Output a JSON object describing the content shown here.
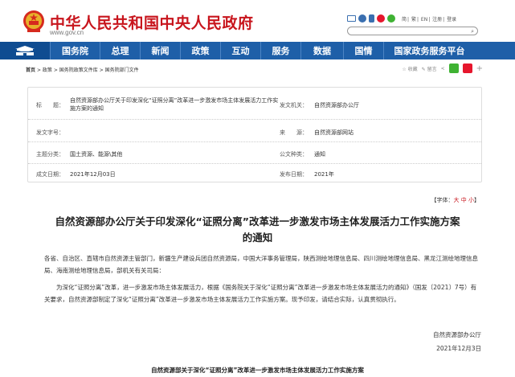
{
  "header": {
    "site_title": "中华人民共和国中央人民政府",
    "site_url": "www.gov.cn",
    "top_links": [
      "简",
      "繁",
      "EN",
      "注册",
      "登录"
    ]
  },
  "nav": {
    "items": [
      "国务院",
      "总理",
      "新闻",
      "政策",
      "互动",
      "服务",
      "数据",
      "国情",
      "国家政务服务平台"
    ]
  },
  "breadcrumb": {
    "items": [
      "首页",
      "政策",
      "国务院政策文件库",
      "国务院部门文件"
    ],
    "sep": ">"
  },
  "share": {
    "favorite": "收藏",
    "print": "留言"
  },
  "info": {
    "title_label": "标　　题：",
    "title_value": "自然资源部办公厅关于印发深化“证照分离”改革进一步激发市场主体发展活力工作实施方案的通知",
    "issuer_label": "发文机关：",
    "issuer_value": "自然资源部办公厅",
    "doc_no_label": "发文字号：",
    "doc_no_value": "",
    "source_label": "来　　源：",
    "source_value": "自然资源部网站",
    "topic_label": "主题分类：",
    "topic_value": "国土资源、能源\\其他",
    "type_label": "公文种类：",
    "type_value": "通知",
    "written_label": "成文日期：",
    "written_value": "2021年12月03日",
    "published_label": "发布日期：",
    "published_value": "2021年"
  },
  "fontsize": {
    "prefix": "【字体：",
    "big": "大",
    "mid": "中",
    "small": "小",
    "suffix": "】"
  },
  "article": {
    "title": "自然资源部办公厅关于印发深化“证照分离”改革进一步激发市场主体发展活力工作实施方案的通知",
    "recipients": "各省、自治区、直辖市自然资源主管部门，新疆生产建设兵团自然资源局，中国大洋事务管理局，陕西测绘地理信息局、四川测绘地理信息局、黑龙江测绘地理信息局、海南测绘地理信息局，部机关有关司局：",
    "body": "为深化“证照分离”改革，进一步激发市场主体发展活力，根据《国务院关于深化“证照分离”改革进一步激发市场主体发展活力的通知》（国发〔2021〕7号）有关要求，自然资源部制定了深化“证照分离”改革进一步激发市场主体发展活力工作实施方案。现予印发，请结合实际，认真贯彻执行。",
    "sign_org": "自然资源部办公厅",
    "sign_date": "2021年12月3日",
    "subtitle": "自然资源部关于深化“证照分离”改革进一步激发市场主体发展活力工作实施方案"
  },
  "colors": {
    "brand_red": "#c8151d",
    "nav_blue": "#1e5fa8"
  }
}
